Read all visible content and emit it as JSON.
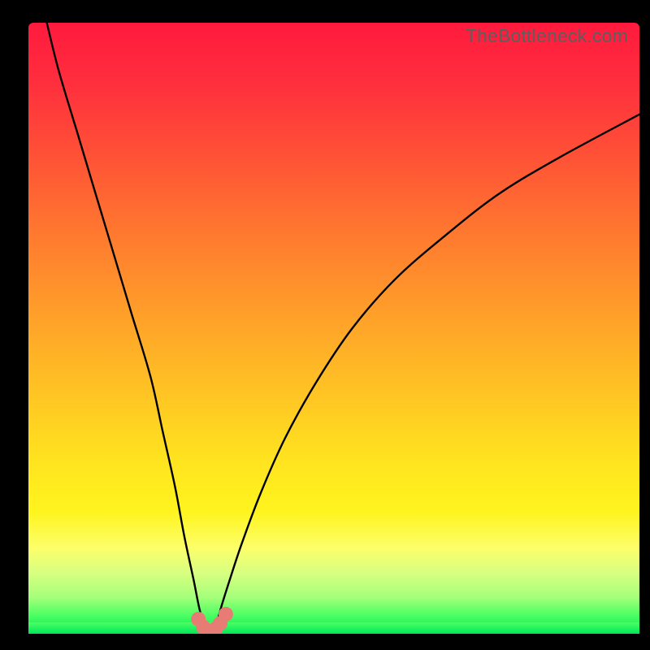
{
  "watermark": "TheBottleneck.com",
  "colors": {
    "frame": "#000000",
    "curve": "#000000",
    "marker_fill": "#e77c74",
    "marker_stroke": "#d85a52"
  },
  "chart_data": {
    "type": "line",
    "title": "",
    "xlabel": "",
    "ylabel": "",
    "xlim": [
      0,
      100
    ],
    "ylim": [
      0,
      100
    ],
    "grid": false,
    "legend": false,
    "series": [
      {
        "name": "bottleneck-curve",
        "x": [
          3,
          5,
          8,
          11,
          14,
          17,
          20,
          22,
          24,
          25.5,
          27,
          28,
          28.8,
          29.4,
          29.8,
          30.2,
          30.8,
          31.5,
          33,
          35,
          38,
          42,
          47,
          53,
          60,
          68,
          77,
          87,
          100
        ],
        "y": [
          100,
          92,
          82,
          72,
          62,
          52,
          42,
          33,
          24,
          16,
          9,
          4,
          1.5,
          0.6,
          0.3,
          0.6,
          1.6,
          4.2,
          9,
          15,
          23,
          32,
          41,
          50,
          58,
          65,
          72,
          78,
          85
        ]
      }
    ],
    "markers": {
      "name": "bottom-points",
      "x": [
        27.8,
        28.6,
        29.3,
        29.9,
        30.6,
        31.4,
        32.3
      ],
      "y": [
        2.4,
        1.1,
        0.5,
        0.4,
        0.8,
        1.7,
        3.2
      ]
    },
    "gradient_stops": [
      {
        "pos": 0.0,
        "color": "#ff1a3d"
      },
      {
        "pos": 0.22,
        "color": "#ff5236"
      },
      {
        "pos": 0.48,
        "color": "#ffa029"
      },
      {
        "pos": 0.72,
        "color": "#ffe41f"
      },
      {
        "pos": 0.86,
        "color": "#fcff6a"
      },
      {
        "pos": 0.94,
        "color": "#a6ff7a"
      },
      {
        "pos": 1.0,
        "color": "#00e659"
      }
    ]
  }
}
